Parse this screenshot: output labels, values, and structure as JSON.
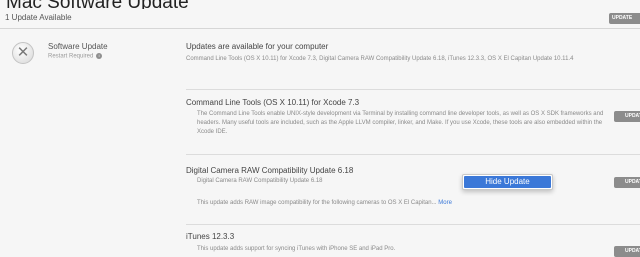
{
  "top_title": "Mac Software Update",
  "count_label": "1 Update Available",
  "update_all_label": "UPDATE",
  "app": {
    "name": "Software Update",
    "status": "Restart Required",
    "summary_title": "Updates are available for your computer",
    "summary_desc": "Command Line Tools (OS X 10.11) for Xcode 7.3, Digital Camera RAW Compatibility Update 6.18, iTunes 12.3.3, OS X El Capitan Update 10.11.4"
  },
  "items": [
    {
      "title": "Command Line Tools (OS X 10.11) for Xcode 7.3",
      "desc": "The Command Line Tools enable UNIX-style development via Terminal by installing command line developer tools, as well as OS X SDK frameworks and headers. Many useful tools are included, such as the Apple LLVM compiler, linker, and Make. If you use Xcode, these tools are also embedded within the Xcode IDE.",
      "button": "UPDATE"
    },
    {
      "title": "Digital Camera RAW Compatibility Update 6.18",
      "subtitle": "Digital Camera RAW Compatibility Update 6.18",
      "desc": "This update adds RAW image compatibility for the following cameras to OS X El Capitan...",
      "more": "More",
      "button": "UPDATE"
    },
    {
      "title": "iTunes 12.3.3",
      "desc": "This update adds support for syncing iTunes with iPhone SE and iPad Pro.",
      "button": "UPDATE"
    }
  ],
  "context_menu": {
    "item": "Hide Update"
  },
  "icons": {
    "app": "software-update-x-icon",
    "info": "info-icon"
  }
}
